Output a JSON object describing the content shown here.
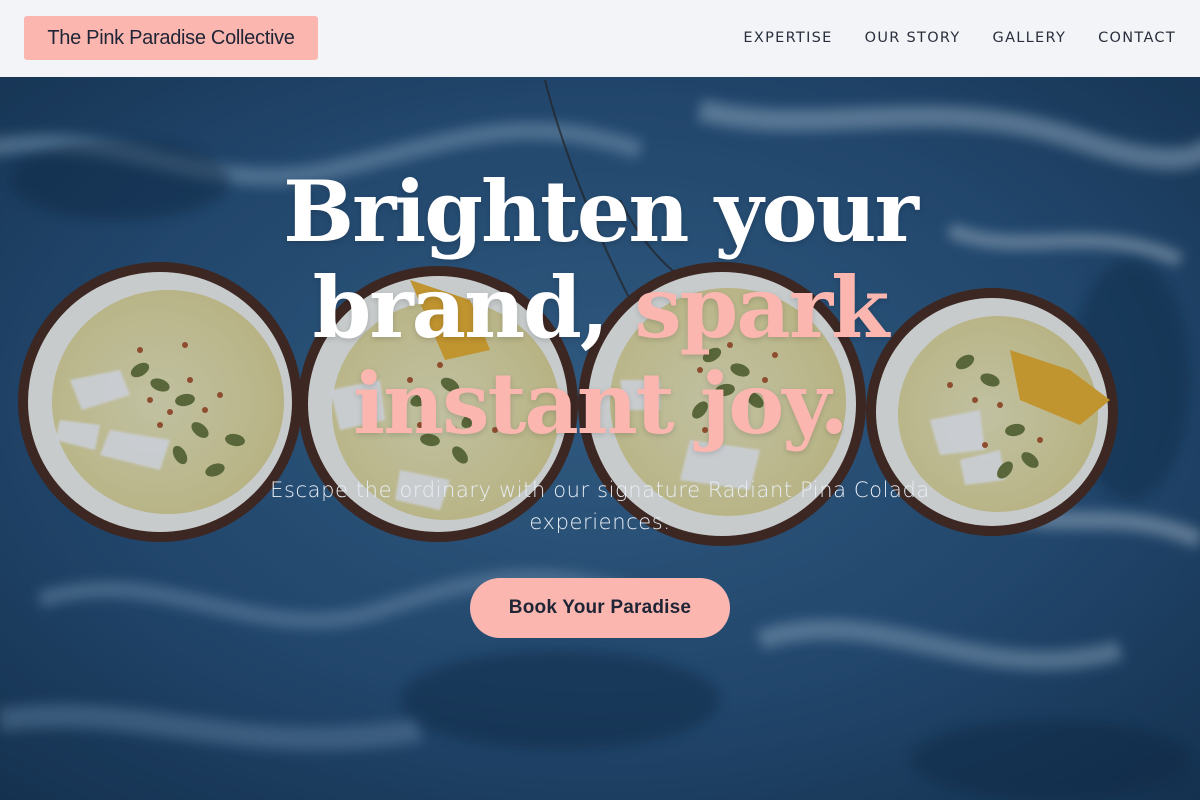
{
  "brand": {
    "name": "The Pink Paradise Collective"
  },
  "nav": {
    "items": [
      {
        "label": "EXPERTISE"
      },
      {
        "label": "OUR STORY"
      },
      {
        "label": "GALLERY"
      },
      {
        "label": "CONTACT"
      }
    ]
  },
  "hero": {
    "headline_line1": "Brighten your",
    "headline_line2_white": "brand, ",
    "headline_line2_accent": "spark",
    "headline_line3_accent": "instant joy.",
    "subtitle": "Escape the ordinary with our signature Radiant Pina Colada experiences.",
    "cta_label": "Book Your Paradise"
  },
  "colors": {
    "accent_pink": "#fbb6b0",
    "header_bg": "#f3f4f7",
    "text_dark": "#1f2535",
    "backdrop_blue": "#1f4266"
  },
  "images": {
    "background": "coconut-smoothie-bowls-on-blue-marble"
  }
}
